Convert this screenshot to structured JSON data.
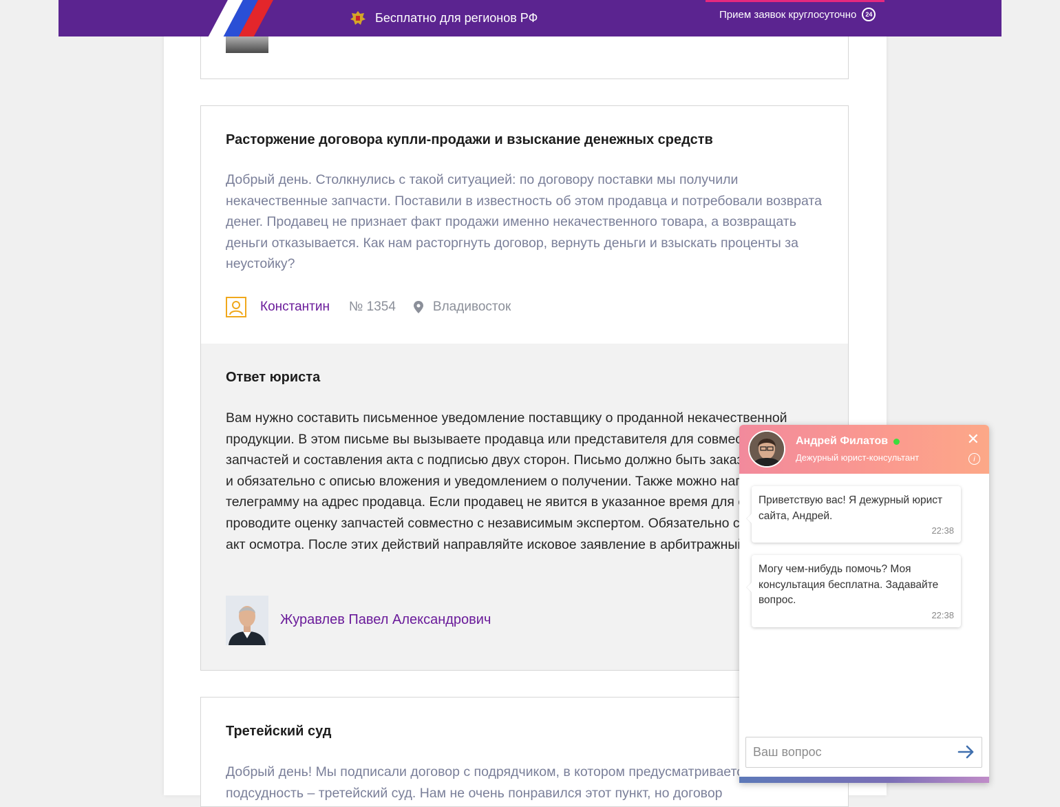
{
  "header": {
    "free_text": "Бесплатно для регионов РФ",
    "hours_text": "Прием заявок круглосуточно",
    "hours_badge": "24",
    "colors": {
      "background": "#5b2490",
      "accent": "#e6297e"
    }
  },
  "question": {
    "title": "Расторжение договора купли-продажи и взыскание денежных средств",
    "body": "Добрый день. Столкнулись с такой ситуацией: по договору поставки мы получили некачественные запчасти. Поставили в известность об этом продавца и потребовали возврата денег. Продавец не признает факт продажи именно некачественного товара, а возвращать деньги отказывается. Как нам расторгнуть договор, вернуть деньги и взыскать проценты за неустойку?",
    "author": "Константин",
    "number": "№ 1354",
    "city": "Владивосток"
  },
  "answer": {
    "title": "Ответ юриста",
    "body": "Вам нужно составить письменное уведомление поставщику о проданной некачественной продукции. В этом письме вы вызываете продавца или представителя для совместного осмотра запчастей и составления акта с подписью двух сторон. Письмо должно быть заказным, ценное и обязательно с описью вложения и уведомлением о получении. Также можно направить телеграмму на адрес продавца. Если продавец не явится в указанное время для осмотра, проводите оценку запчастей совместно с независимым экспертом. Обязательно составляйте акт осмотра. После этих действий направляйте исковое заявление в арбитражный суд.",
    "lawyer": "Журавлев Павел Александрович"
  },
  "next_question": {
    "title": "Третейский суд",
    "body": "Добрый день! Мы подписали договор с подрядчиком, в котором предусматривается договорная подсудность – третейский суд. Нам не очень понравился этот пункт, но договор"
  },
  "chat": {
    "name": "Андрей Филатов",
    "role": "Дежурный юрист-консультант",
    "messages": [
      {
        "text": "Приветствую вас! Я дежурный юрист сайта, Андрей.",
        "time": "22:38"
      },
      {
        "text": "Могу чем-нибудь помочь? Моя консультация бесплатна. Задавайте вопрос.",
        "time": "22:38"
      }
    ],
    "input_placeholder": "Ваш вопрос",
    "colors": {
      "header_start": "#f28a9c",
      "header_end": "#fca888",
      "online": "#3ddc3d"
    }
  },
  "icons": {
    "emblem": "russian-emblem-icon",
    "clock24": "24-hours-icon",
    "user": "user-icon",
    "location": "location-pin-icon",
    "close": "close-icon",
    "info": "info-icon",
    "send": "send-arrow-icon"
  }
}
